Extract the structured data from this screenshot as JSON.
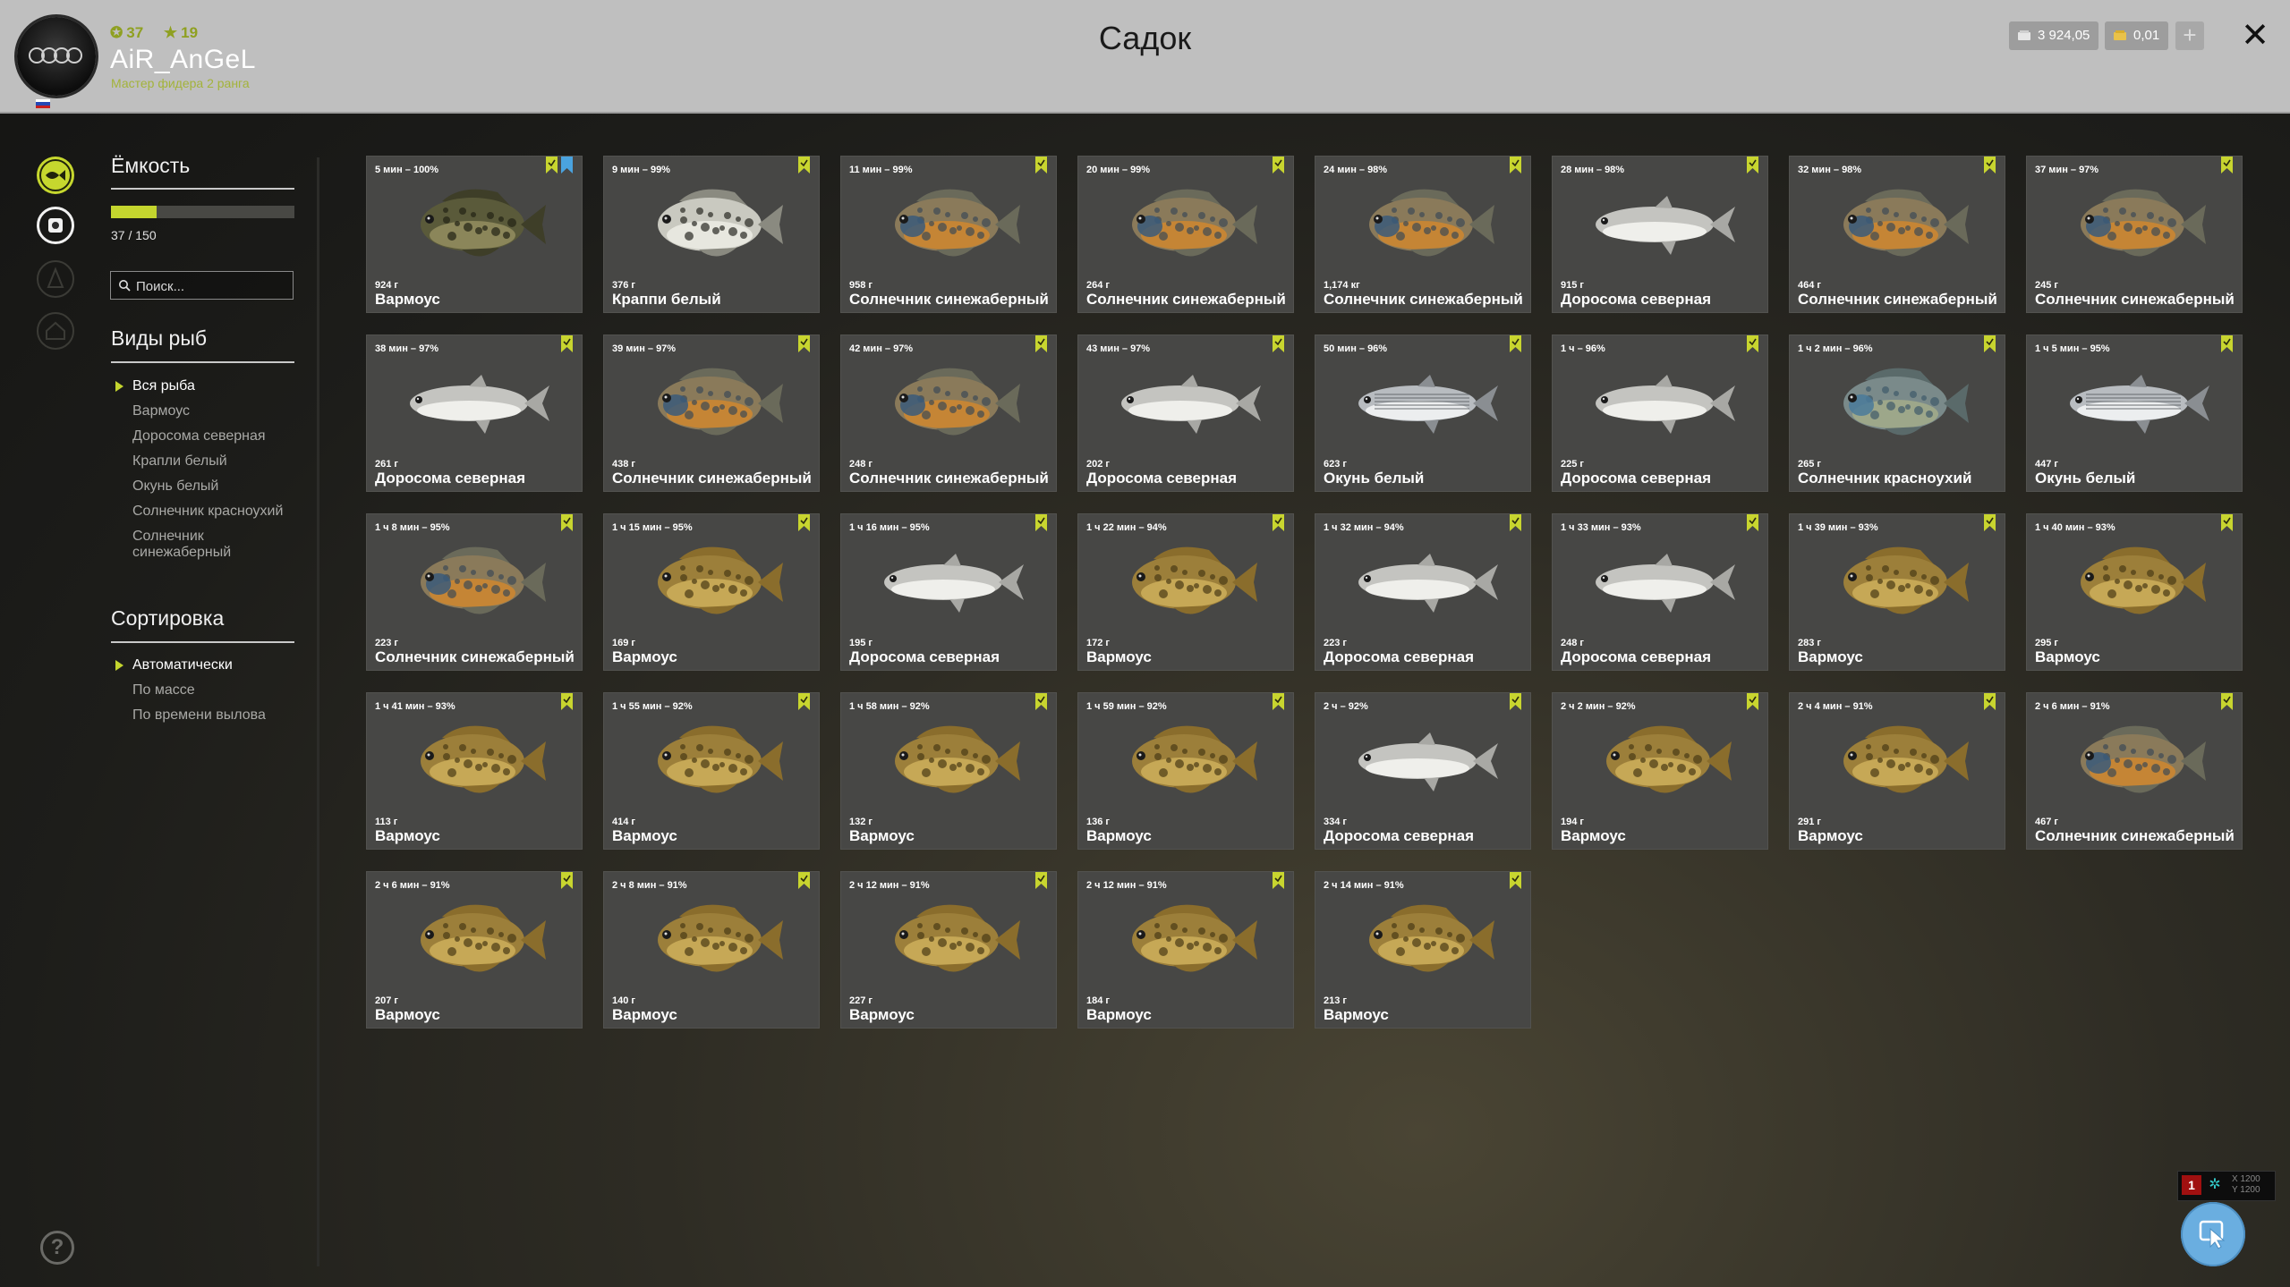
{
  "header": {
    "title": "Садок",
    "player": {
      "name": "AiR_AnGeL",
      "rank": "Мастер фидера 2 ранга",
      "level": "37",
      "stars": "19",
      "flag": "russia-flag"
    },
    "currency": {
      "silver": "3 924,05",
      "gold": "0,01"
    },
    "plus_label": "+",
    "close_label": "✕"
  },
  "sidebar": {
    "capacity": {
      "heading": "Ёмкость",
      "count": "37 / 150",
      "fill_fraction": 0.2467
    },
    "search": {
      "placeholder": "Поиск..."
    },
    "species": {
      "heading": "Виды рыб",
      "items": [
        "Вся рыба",
        "Вармоус",
        "Доросома северная",
        "Крапли белый",
        "Окунь белый",
        "Солнечник красноухий",
        "Солнечник синежаберный"
      ],
      "selected_index": 0
    },
    "sorting": {
      "heading": "Сортировка",
      "items": [
        "Автоматически",
        "По массе",
        "По времени вылова"
      ],
      "selected_index": 0
    },
    "help_label": "?"
  },
  "colors": {
    "accent": "#c4d52e",
    "bookmark": "#c8d52f",
    "bookmark_alt": "#4aa3df",
    "fab": "#6aaee0"
  },
  "cursor_info": {
    "x": "X 1200",
    "y": "Y 1200"
  },
  "fish": [
    {
      "time": "5 мин – 100%",
      "weight": "924 г",
      "name": "Вармоус",
      "kind": "warmouth-dark",
      "extra_bookmark": true
    },
    {
      "time": "9 мин – 99%",
      "weight": "376 г",
      "name": "Краппи белый",
      "kind": "crappie"
    },
    {
      "time": "11 мин – 99%",
      "weight": "958 г",
      "name": "Солнечник синежаберный",
      "kind": "bluegill"
    },
    {
      "time": "20 мин – 99%",
      "weight": "264 г",
      "name": "Солнечник синежаберный",
      "kind": "bluegill"
    },
    {
      "time": "24 мин – 98%",
      "weight": "1,174 кг",
      "name": "Солнечник синежаберный",
      "kind": "bluegill"
    },
    {
      "time": "28 мин – 98%",
      "weight": "915 г",
      "name": "Доросома северная",
      "kind": "shad"
    },
    {
      "time": "32 мин – 98%",
      "weight": "464 г",
      "name": "Солнечник синежаберный",
      "kind": "bluegill"
    },
    {
      "time": "37 мин – 97%",
      "weight": "245 г",
      "name": "Солнечник синежаберный",
      "kind": "bluegill"
    },
    {
      "time": "38 мин – 97%",
      "weight": "261 г",
      "name": "Доросома северная",
      "kind": "shad"
    },
    {
      "time": "39 мин – 97%",
      "weight": "438 г",
      "name": "Солнечник синежаберный",
      "kind": "bluegill"
    },
    {
      "time": "42 мин – 97%",
      "weight": "248 г",
      "name": "Солнечник синежаберный",
      "kind": "bluegill"
    },
    {
      "time": "43 мин – 97%",
      "weight": "202 г",
      "name": "Доросома северная",
      "kind": "shad"
    },
    {
      "time": "50 мин – 96%",
      "weight": "623 г",
      "name": "Окунь белый",
      "kind": "whitebass"
    },
    {
      "time": "1 ч – 96%",
      "weight": "225 г",
      "name": "Доросома северная",
      "kind": "shad"
    },
    {
      "time": "1 ч 2 мин – 96%",
      "weight": "265 г",
      "name": "Солнечник красноухий",
      "kind": "redear"
    },
    {
      "time": "1 ч 5 мин – 95%",
      "weight": "447 г",
      "name": "Окунь белый",
      "kind": "whitebass"
    },
    {
      "time": "1 ч 8 мин – 95%",
      "weight": "223 г",
      "name": "Солнечник синежаберный",
      "kind": "bluegill"
    },
    {
      "time": "1 ч 15 мин – 95%",
      "weight": "169 г",
      "name": "Вармоус",
      "kind": "warmouth"
    },
    {
      "time": "1 ч 16 мин – 95%",
      "weight": "195 г",
      "name": "Доросома северная",
      "kind": "shad"
    },
    {
      "time": "1 ч 22 мин – 94%",
      "weight": "172 г",
      "name": "Вармоус",
      "kind": "warmouth"
    },
    {
      "time": "1 ч 32 мин – 94%",
      "weight": "223 г",
      "name": "Доросома северная",
      "kind": "shad"
    },
    {
      "time": "1 ч 33 мин – 93%",
      "weight": "248 г",
      "name": "Доросома северная",
      "kind": "shad"
    },
    {
      "time": "1 ч 39 мин – 93%",
      "weight": "283 г",
      "name": "Вармоус",
      "kind": "warmouth"
    },
    {
      "time": "1 ч 40 мин – 93%",
      "weight": "295 г",
      "name": "Вармоус",
      "kind": "warmouth"
    },
    {
      "time": "1 ч 41 мин – 93%",
      "weight": "113 г",
      "name": "Вармоус",
      "kind": "warmouth"
    },
    {
      "time": "1 ч 55 мин – 92%",
      "weight": "414 г",
      "name": "Вармоус",
      "kind": "warmouth"
    },
    {
      "time": "1 ч 58 мин – 92%",
      "weight": "132 г",
      "name": "Вармоус",
      "kind": "warmouth"
    },
    {
      "time": "1 ч 59 мин – 92%",
      "weight": "136 г",
      "name": "Вармоус",
      "kind": "warmouth"
    },
    {
      "time": "2 ч – 92%",
      "weight": "334 г",
      "name": "Доросома северная",
      "kind": "shad"
    },
    {
      "time": "2 ч 2 мин – 92%",
      "weight": "194 г",
      "name": "Вармоус",
      "kind": "warmouth"
    },
    {
      "time": "2 ч 4 мин – 91%",
      "weight": "291 г",
      "name": "Вармоус",
      "kind": "warmouth"
    },
    {
      "time": "2 ч 6 мин – 91%",
      "weight": "467 г",
      "name": "Солнечник синежаберный",
      "kind": "bluegill"
    },
    {
      "time": "2 ч 6 мин – 91%",
      "weight": "207 г",
      "name": "Вармоус",
      "kind": "warmouth"
    },
    {
      "time": "2 ч 8 мин – 91%",
      "weight": "140 г",
      "name": "Вармоус",
      "kind": "warmouth"
    },
    {
      "time": "2 ч 12 мин – 91%",
      "weight": "227 г",
      "name": "Вармоус",
      "kind": "warmouth"
    },
    {
      "time": "2 ч 12 мин – 91%",
      "weight": "184 г",
      "name": "Вармоус",
      "kind": "warmouth"
    },
    {
      "time": "2 ч 14 мин – 91%",
      "weight": "213 г",
      "name": "Вармоус",
      "kind": "warmouth"
    }
  ]
}
